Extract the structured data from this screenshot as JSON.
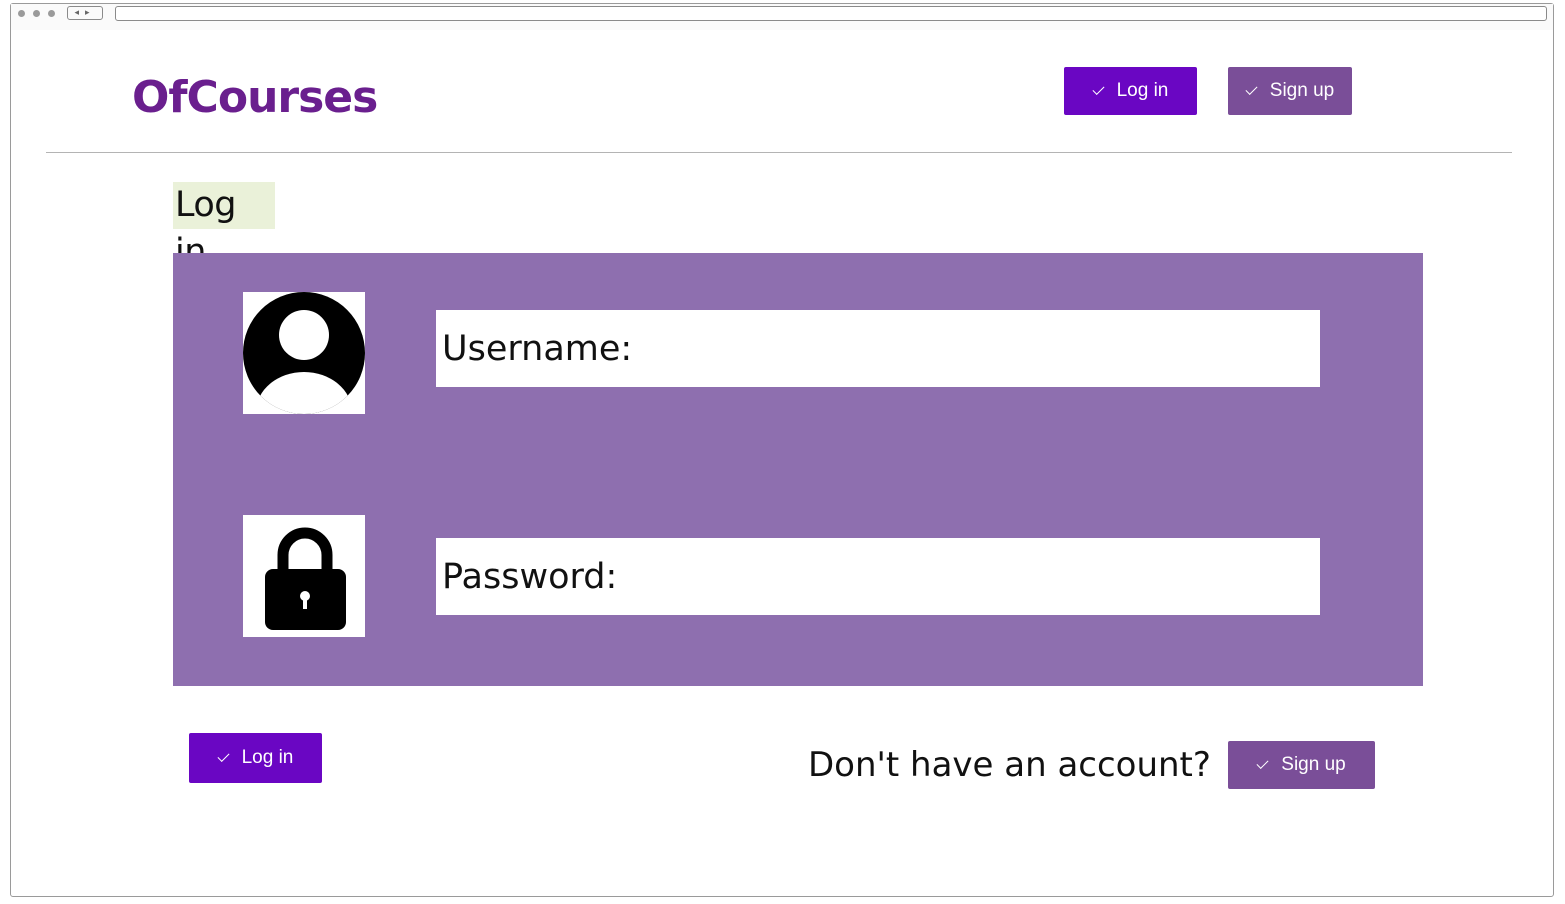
{
  "header": {
    "brand": "OfCourses",
    "login_button": "Log in",
    "signup_button": "Sign up"
  },
  "page": {
    "title": "Log in"
  },
  "form": {
    "username_label": "Username:",
    "password_label": "Password:",
    "login_button": "Log in"
  },
  "signup_cta": {
    "text": "Don't have an account?",
    "button": "Sign up"
  },
  "icons": {
    "user": "user-avatar-icon",
    "lock": "lock-icon",
    "check": "check-icon"
  },
  "colors": {
    "brand": "#6a1f8e",
    "primary_button": "#6a06c3",
    "secondary_button": "#7a4e98",
    "panel": "#8e6faf",
    "title_highlight": "#eaf1d9"
  }
}
